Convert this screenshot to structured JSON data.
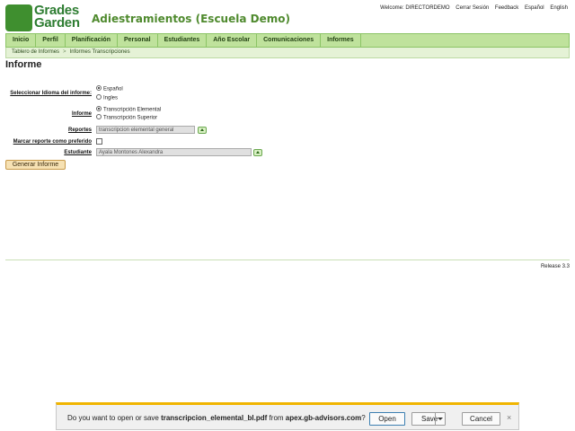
{
  "brand": {
    "line1": "Grades",
    "line2": "Garden",
    "school": "Adiestramientos (Escuela Demo)"
  },
  "toplinks": {
    "welcome": "Welcome: DIRECTORDEMO",
    "logout": "Cerrar Sesión",
    "feedback": "Feedback",
    "espanol": "Español",
    "english": "English"
  },
  "nav": [
    "Inicio",
    "Perfil",
    "Planificación",
    "Personal",
    "Estudiantes",
    "Año Escolar",
    "Comunicaciones",
    "Informes"
  ],
  "breadcrumb": {
    "home": "Tablero de Informes",
    "sep": ">",
    "current": "Informes Transcripciones"
  },
  "page": {
    "title": "Informe"
  },
  "form": {
    "language_label": "Seleccionar Idioma del informe:",
    "lang_opt1": "Español",
    "lang_opt2": "Ingles",
    "report_label": "Informe",
    "report_opt1": "Transcripción Elemental",
    "report_opt2": "Transcripción Superior",
    "reportes_label": "Reportes",
    "reportes_value": "transcripcion elemental general",
    "preferred_label": "Marcar reporte como preferido",
    "student_label": "Estudiante",
    "student_value": "Ayala Montones Alexandra",
    "generate_button": "Generar Informe"
  },
  "footer": {
    "release": "Release 3.3"
  },
  "download": {
    "prefix": "Do you want to open or save ",
    "filename": "transcripcion_elemental_bl.pdf",
    "middle": " from ",
    "site": "apex.gb-advisors.com",
    "suffix": "?",
    "open": "Open",
    "save": "Save",
    "cancel": "Cancel",
    "close": "×"
  }
}
